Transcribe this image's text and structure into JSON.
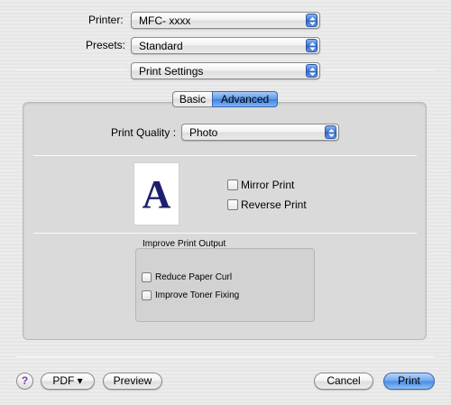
{
  "printer": {
    "label": "Printer:",
    "value": "MFC- xxxx"
  },
  "presets": {
    "label": "Presets:",
    "value": "Standard"
  },
  "section_popup": {
    "value": "Print Settings"
  },
  "tabs": [
    {
      "label": "Basic"
    },
    {
      "label": "Advanced",
      "selected": true
    }
  ],
  "print_quality": {
    "label": "Print Quality :",
    "value": "Photo"
  },
  "preview": {
    "letter": "A"
  },
  "options": {
    "mirror_print": {
      "label": "Mirror Print",
      "checked": false
    },
    "reverse_print": {
      "label": "Reverse Print",
      "checked": false
    }
  },
  "improve_group": {
    "title": "Improve Print Output",
    "reduce_paper_curl": {
      "label": "Reduce Paper Curl",
      "checked": false
    },
    "improve_toner_fixing": {
      "label": "Improve Toner Fixing",
      "checked": false
    }
  },
  "footer": {
    "help_label": "?",
    "pdf_label": "PDF ▾",
    "preview_label": "Preview",
    "cancel_label": "Cancel",
    "print_label": "Print"
  },
  "icons": {
    "popup_arrows": "up-down-arrows-icon",
    "help": "question-mark-icon"
  },
  "colors": {
    "accent": "#3f80df",
    "preview_letter": "#1c1f6e"
  }
}
